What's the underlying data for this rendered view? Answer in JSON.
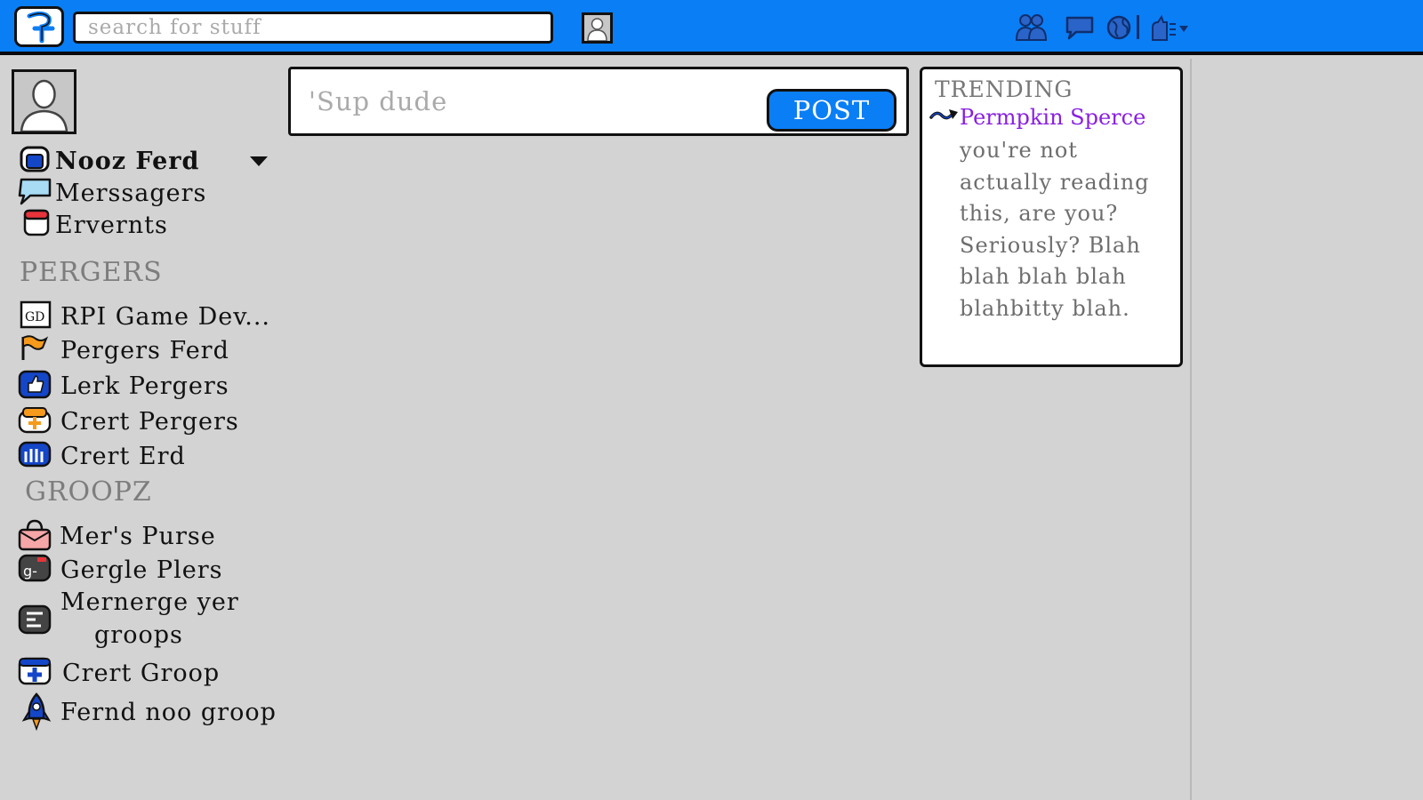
{
  "header": {
    "search_placeholder": "search for stuff",
    "icons": [
      "logo-icon",
      "user-avatar-icon",
      "friends-icon",
      "chat-icon",
      "globe-icon",
      "account-settings-icon"
    ]
  },
  "composer": {
    "placeholder": "'Sup dude",
    "post_label": "POST"
  },
  "sidebar": {
    "profile_name": "Nooz Ferd",
    "items": [
      {
        "label": "Merssagers",
        "icon": "messages-icon"
      },
      {
        "label": "Ervernts",
        "icon": "events-icon"
      }
    ],
    "pages_heading": "PERGERS",
    "pages": [
      {
        "label": "RPI Game Dev...",
        "icon": "game-dev-page-icon"
      },
      {
        "label": "Pergers Ferd",
        "icon": "flag-icon"
      },
      {
        "label": "Lerk Pergers",
        "icon": "like-icon"
      },
      {
        "label": "Crert Pergers",
        "icon": "create-page-icon"
      },
      {
        "label": "Crert Erd",
        "icon": "ad-icon"
      }
    ],
    "groups_heading": "GROOPZ",
    "groups": [
      {
        "label": "Mer's Purse",
        "icon": "purse-icon"
      },
      {
        "label": "Gergle Plers",
        "icon": "google-plus-icon"
      },
      {
        "label": "Mernerge yer",
        "label2": "groops",
        "icon": "manage-groups-icon"
      },
      {
        "label": "Crert Groop",
        "icon": "create-group-icon"
      },
      {
        "label": "Fernd noo groop",
        "icon": "rocket-icon"
      }
    ]
  },
  "trending": {
    "heading": "TRENDING",
    "title": "Permpkin Sperce",
    "body": "you're not actually reading this, are you? Seriously? Blah blah blah blah blahbitty blah."
  },
  "colors": {
    "brand_blue": "#0a7ef5",
    "background": "#d3d3d3",
    "trend_purple": "#8a1fe0"
  }
}
